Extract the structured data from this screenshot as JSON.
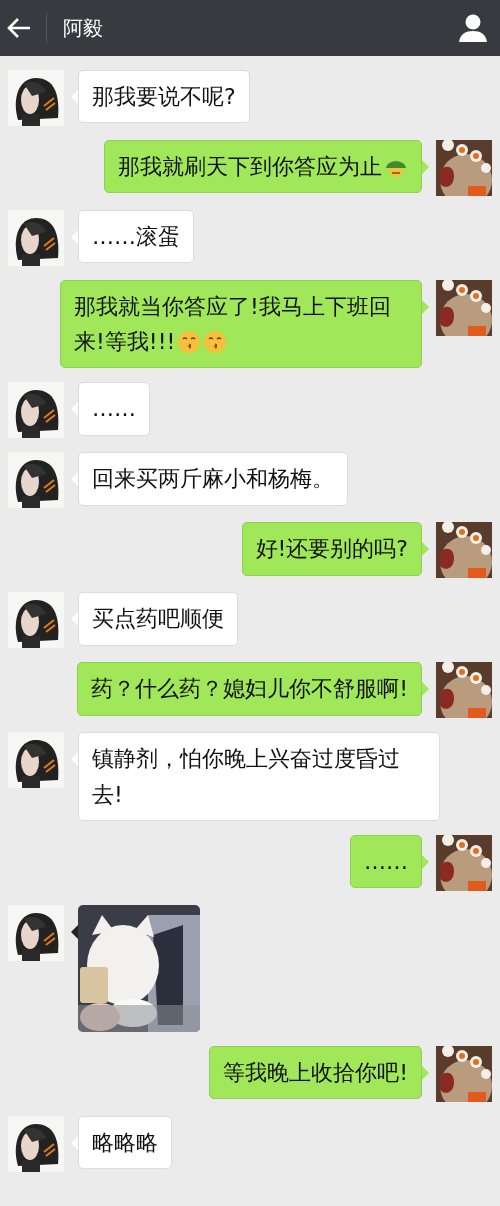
{
  "header": {
    "title": "阿毅"
  },
  "messages": [
    {
      "outgoing": false,
      "kind": "text",
      "text": "那我要说不呢?"
    },
    {
      "outgoing": true,
      "kind": "text",
      "text": "那我就刷天下到你答应为止",
      "emojis": [
        {
          "kind": "turtle"
        }
      ]
    },
    {
      "outgoing": false,
      "kind": "text",
      "text": "……滚蛋"
    },
    {
      "outgoing": true,
      "kind": "text",
      "text": "那我就当你答应了!我马上下班回来!等我!!!",
      "emojis": [
        {
          "kind": "kiss"
        },
        {
          "kind": "kiss"
        }
      ]
    },
    {
      "outgoing": false,
      "kind": "text",
      "text": "……"
    },
    {
      "outgoing": false,
      "kind": "text",
      "text": "回来买两斤麻小和杨梅。"
    },
    {
      "outgoing": true,
      "kind": "text",
      "text": "好!还要别的吗?"
    },
    {
      "outgoing": false,
      "kind": "text",
      "text": "买点药吧顺便"
    },
    {
      "outgoing": true,
      "kind": "text",
      "text": "药？什么药？媳妇儿你不舒服啊!"
    },
    {
      "outgoing": false,
      "kind": "text",
      "text": "镇静剂，怕你晚上兴奋过度昏过去!"
    },
    {
      "outgoing": true,
      "kind": "text",
      "text": "……"
    },
    {
      "outgoing": false,
      "kind": "sticker"
    },
    {
      "outgoing": true,
      "kind": "text",
      "text": "等我晚上收拾你吧!"
    },
    {
      "outgoing": false,
      "kind": "text",
      "text": "略略略"
    }
  ]
}
